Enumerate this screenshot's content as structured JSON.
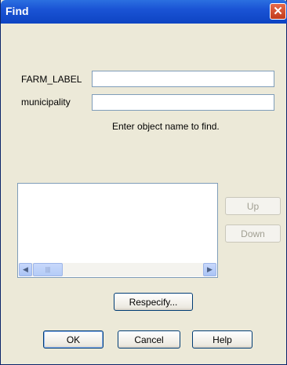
{
  "window": {
    "title": "Find",
    "close_glyph": "✕"
  },
  "fields": [
    {
      "label": "FARM_LABEL",
      "value": ""
    },
    {
      "label": "municipality",
      "value": ""
    }
  ],
  "hint": "Enter object name to find.",
  "list": {
    "items": []
  },
  "scroll": {
    "left_glyph": "◀",
    "right_glyph": "▶",
    "thumb_glyph": "|||"
  },
  "buttons": {
    "up": "Up",
    "down": "Down",
    "respecify": "Respecify...",
    "ok": "OK",
    "cancel": "Cancel",
    "help": "Help"
  }
}
